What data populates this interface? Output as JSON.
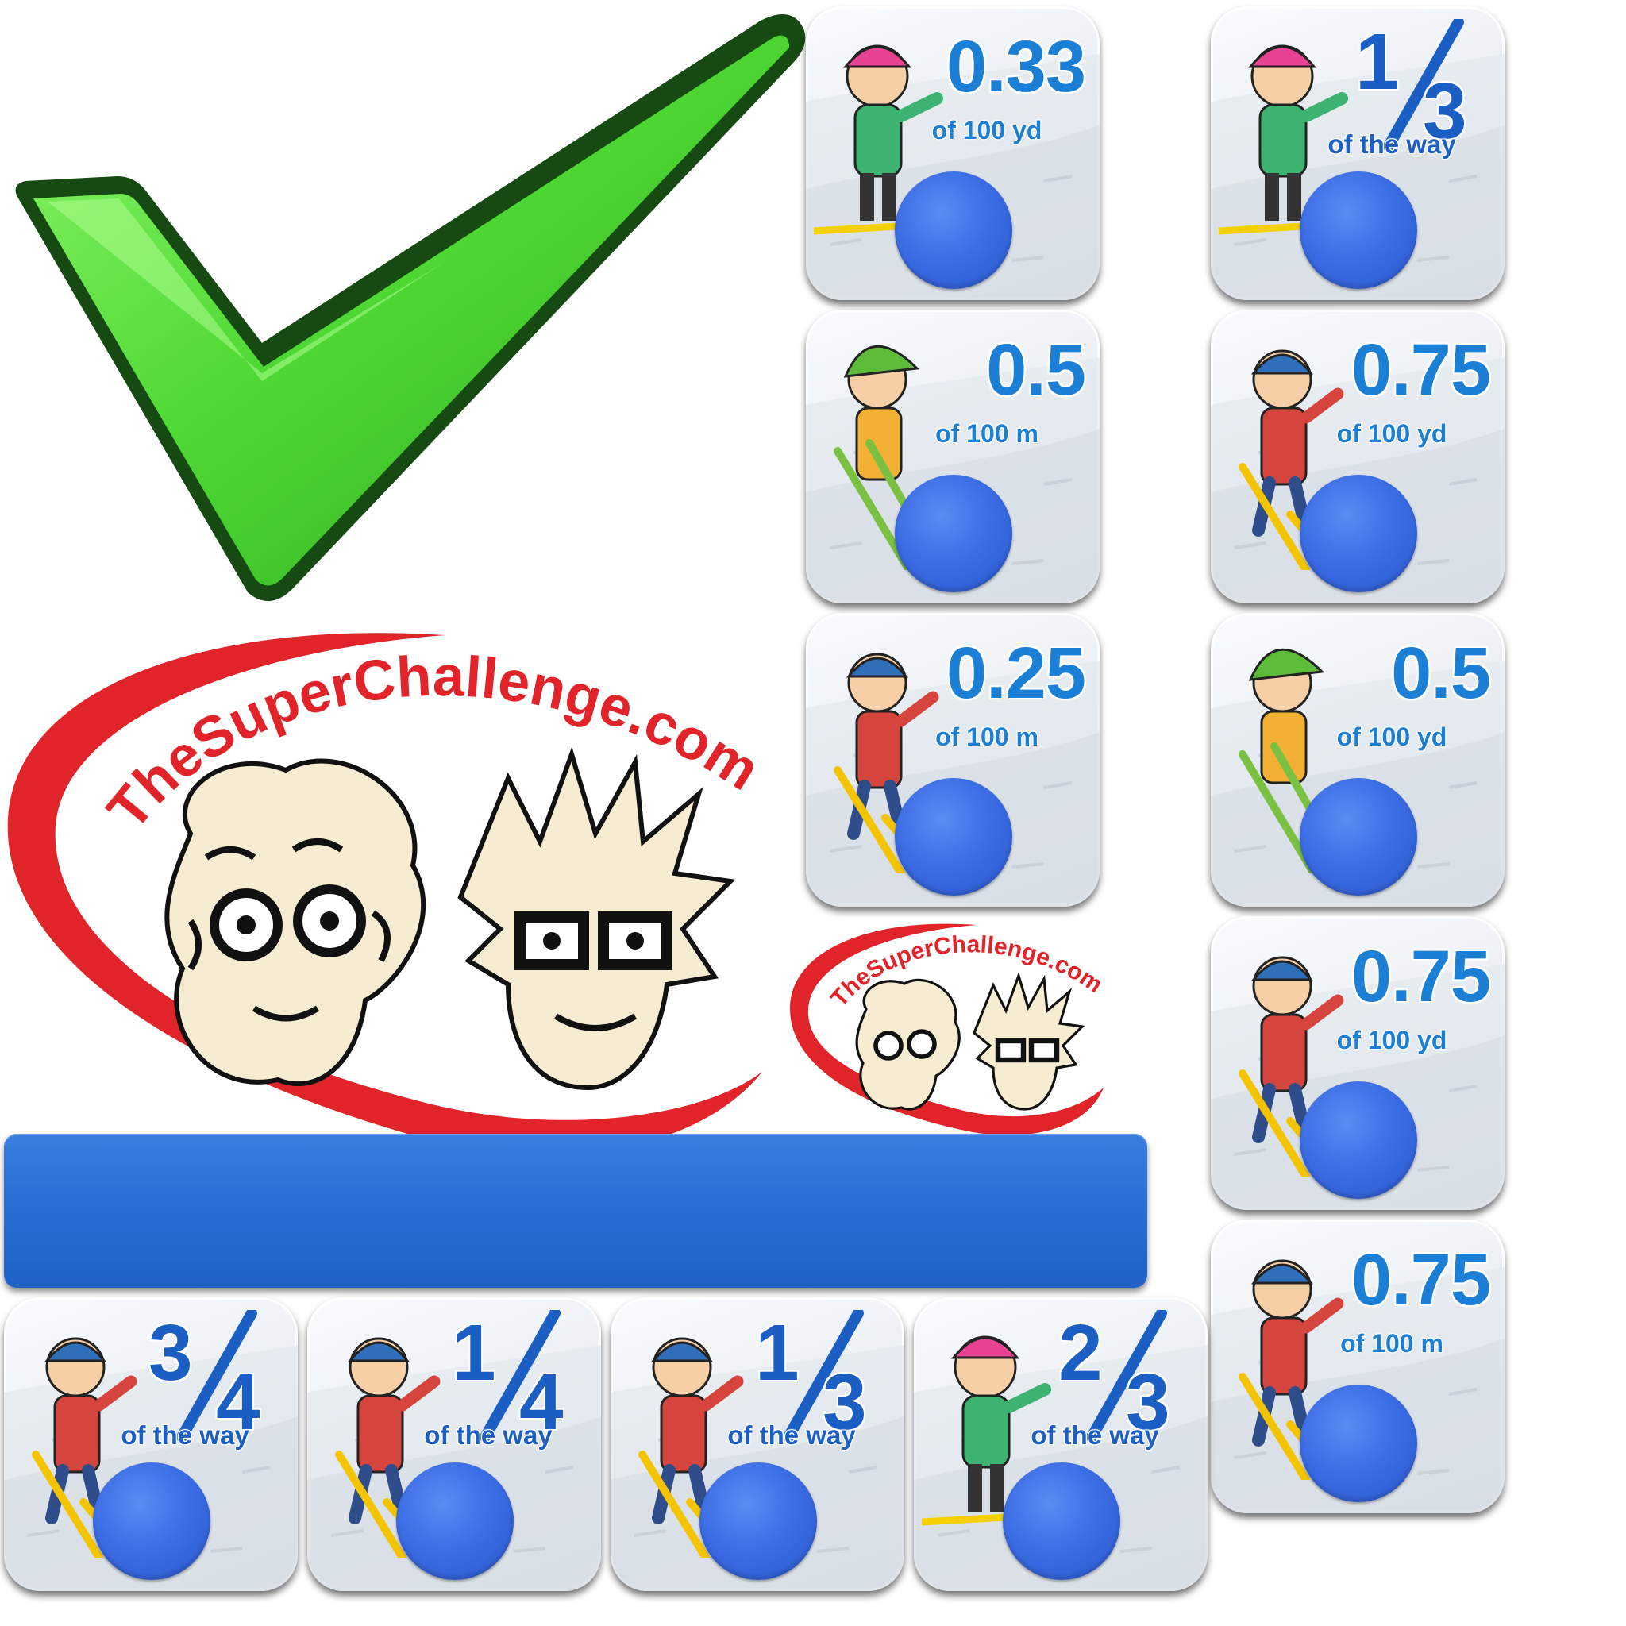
{
  "logo": {
    "text": "TheSuperChallenge.com"
  },
  "colors": {
    "check_green": "#3ecf2a",
    "card_blue": "#1b7fd6",
    "ball_blue": "#3c6ee6",
    "bar_blue": "#2a6fd6",
    "logo_red": "#e0242a"
  },
  "cards": [
    {
      "id": "card-0-33-yd",
      "value": "0.33",
      "unit": "of 100 yd"
    },
    {
      "id": "card-one-third-a",
      "numerator": "1",
      "denominator": "3",
      "unit": "of the way"
    },
    {
      "id": "card-0-5-m",
      "value": "0.5",
      "unit": "of 100 m"
    },
    {
      "id": "card-0-75-yd-a",
      "value": "0.75",
      "unit": "of 100 yd"
    },
    {
      "id": "card-0-25-m",
      "value": "0.25",
      "unit": "of 100 m"
    },
    {
      "id": "card-0-5-yd",
      "value": "0.5",
      "unit": "of 100 yd"
    },
    {
      "id": "card-0-75-yd-b",
      "value": "0.75",
      "unit": "of 100 yd"
    },
    {
      "id": "card-0-75-m",
      "value": "0.75",
      "unit": "of 100 m"
    },
    {
      "id": "card-three-quarters",
      "numerator": "3",
      "denominator": "4",
      "unit": "of the way"
    },
    {
      "id": "card-one-quarter",
      "numerator": "1",
      "denominator": "4",
      "unit": "of the way"
    },
    {
      "id": "card-one-third-b",
      "numerator": "1",
      "denominator": "3",
      "unit": "of the way"
    },
    {
      "id": "card-two-thirds",
      "numerator": "2",
      "denominator": "3",
      "unit": "of the way"
    }
  ]
}
